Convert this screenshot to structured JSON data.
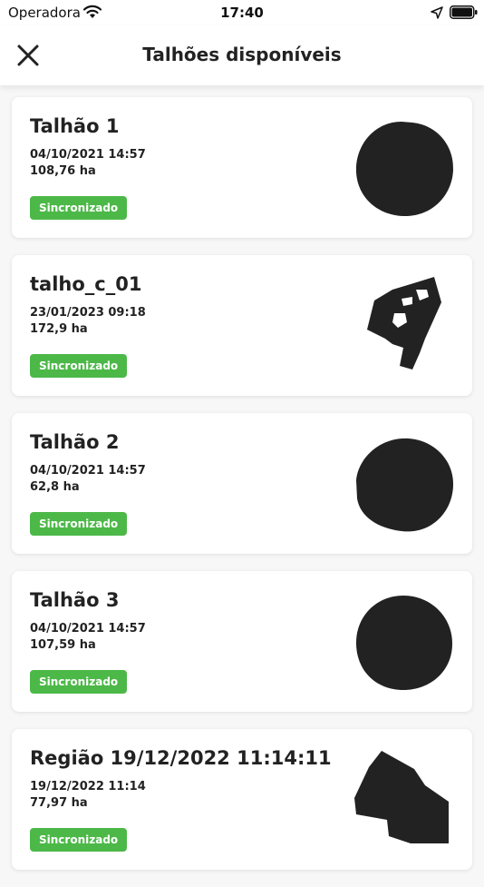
{
  "status_bar": {
    "carrier": "Operadora",
    "time": "17:40",
    "icons": [
      "wifi-icon",
      "location-arrow-icon",
      "battery-icon"
    ]
  },
  "header": {
    "title": "Talhões disponíveis",
    "close_icon": "close-icon"
  },
  "colors": {
    "badge": "#4cb848",
    "shape_fill": "#222222"
  },
  "fields": [
    {
      "name": "Talhão 1",
      "date": "04/10/2021 14:57",
      "area": "108,76 ha",
      "status": "Sincronizado",
      "shape": "circle-shape"
    },
    {
      "name": "talho_c_01",
      "date": "23/01/2023 09:18",
      "area": "172,9 ha",
      "status": "Sincronizado",
      "shape": "irregular-shape"
    },
    {
      "name": "Talhão 2",
      "date": "04/10/2021 14:57",
      "area": "62,8 ha",
      "status": "Sincronizado",
      "shape": "circle-shape"
    },
    {
      "name": "Talhão 3",
      "date": "04/10/2021 14:57",
      "area": "107,59 ha",
      "status": "Sincronizado",
      "shape": "circle-shape"
    },
    {
      "name": "Região 19/12/2022 11:14:11",
      "date": "19/12/2022 11:14",
      "area": "77,97 ha",
      "status": "Sincronizado",
      "shape": "polygon-shape"
    }
  ]
}
